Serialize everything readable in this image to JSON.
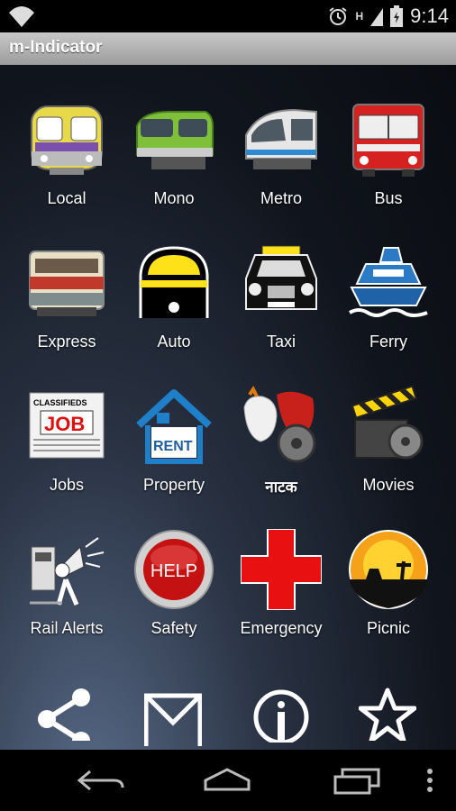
{
  "status_bar": {
    "time": "9:14",
    "network": "H"
  },
  "app": {
    "title": "m-Indicator"
  },
  "grid": [
    {
      "label": "Local",
      "icon": "local-train-icon"
    },
    {
      "label": "Mono",
      "icon": "monorail-icon"
    },
    {
      "label": "Metro",
      "icon": "metro-train-icon"
    },
    {
      "label": "Bus",
      "icon": "bus-icon"
    },
    {
      "label": "Express",
      "icon": "express-train-icon"
    },
    {
      "label": "Auto",
      "icon": "auto-rickshaw-icon"
    },
    {
      "label": "Taxi",
      "icon": "taxi-icon"
    },
    {
      "label": "Ferry",
      "icon": "ferry-icon"
    },
    {
      "label": "Jobs",
      "icon": "jobs-newspaper-icon",
      "icon_text": [
        "CLASSIFIEDS",
        "JOB"
      ]
    },
    {
      "label": "Property",
      "icon": "property-house-icon",
      "icon_text": [
        "RENT"
      ]
    },
    {
      "label": "नाटक",
      "icon": "drama-masks-icon"
    },
    {
      "label": "Movies",
      "icon": "movie-clapper-icon"
    },
    {
      "label": "Rail Alerts",
      "icon": "rail-alerts-megaphone-icon"
    },
    {
      "label": "Safety",
      "icon": "help-button-icon",
      "icon_text": [
        "HELP"
      ]
    },
    {
      "label": "Emergency",
      "icon": "red-cross-icon"
    },
    {
      "label": "Picnic",
      "icon": "picnic-sunset-icon"
    }
  ],
  "bottom_row": [
    "share-icon",
    "mail-icon",
    "info-icon",
    "star-icon"
  ],
  "nav_bar": [
    "back-icon",
    "home-icon",
    "recents-icon",
    "overflow-menu-icon"
  ]
}
